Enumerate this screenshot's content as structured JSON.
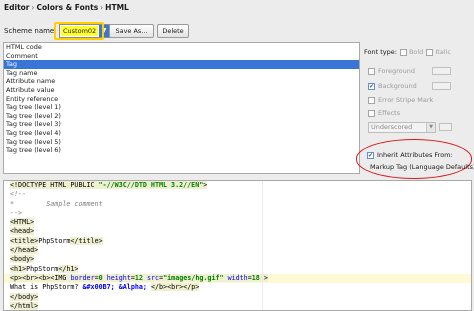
{
  "breadcrumb": {
    "parts": [
      "Editor",
      "Colors & Fonts",
      "HTML"
    ],
    "separator": "›"
  },
  "scheme": {
    "label": "Scheme name:",
    "value": "Custom02",
    "save_as_label": "Save As...",
    "delete_label": "Delete",
    "highlight_color": "#ffff33"
  },
  "attributes_list": {
    "items": [
      "HTML code",
      "Comment",
      "Tag",
      "Tag name",
      "Attribute name",
      "Attribute value",
      "Entity reference",
      "Tag tree (level 1)",
      "Tag tree (level 2)",
      "Tag tree (level 3)",
      "Tag tree (level 4)",
      "Tag tree (level 5)",
      "Tag tree (level 6)"
    ],
    "selected_index": 2,
    "selection_color": "#3875d7"
  },
  "options": {
    "font_type_label": "Font type:",
    "bold_label": "Bold",
    "italic_label": "Italic",
    "foreground_label": "Foreground",
    "background_label": "Background",
    "background_checked": true,
    "error_stripe_label": "Error Stripe Mark",
    "effects_label": "Effects",
    "effect_type": "Underscored",
    "inherit_label": "Inherit Attributes From:",
    "inherit_checked": true,
    "inherit_source": "Markup Tag (Language Defaults)"
  },
  "annotation_color": "#e01818",
  "editor": {
    "lines": [
      "<!DOCTYPE HTML PUBLIC \"-//W3C//DTD HTML 3.2//EN\">",
      "<!--",
      "*        Sample comment",
      "-->",
      "<HTML>",
      "<head>",
      "<title>PhpStorm</title>",
      "</head>",
      "<body>",
      "<h1>PhpStorm</h1>",
      "<p><br><b><IMG border=0 height=12 src=\"images/hg.gif\" width=18 >",
      "What is PhpStorm? &#x00B7; &Alpha; </b><br></p>",
      "</body>",
      "</html>"
    ],
    "current_line_index": 10
  }
}
